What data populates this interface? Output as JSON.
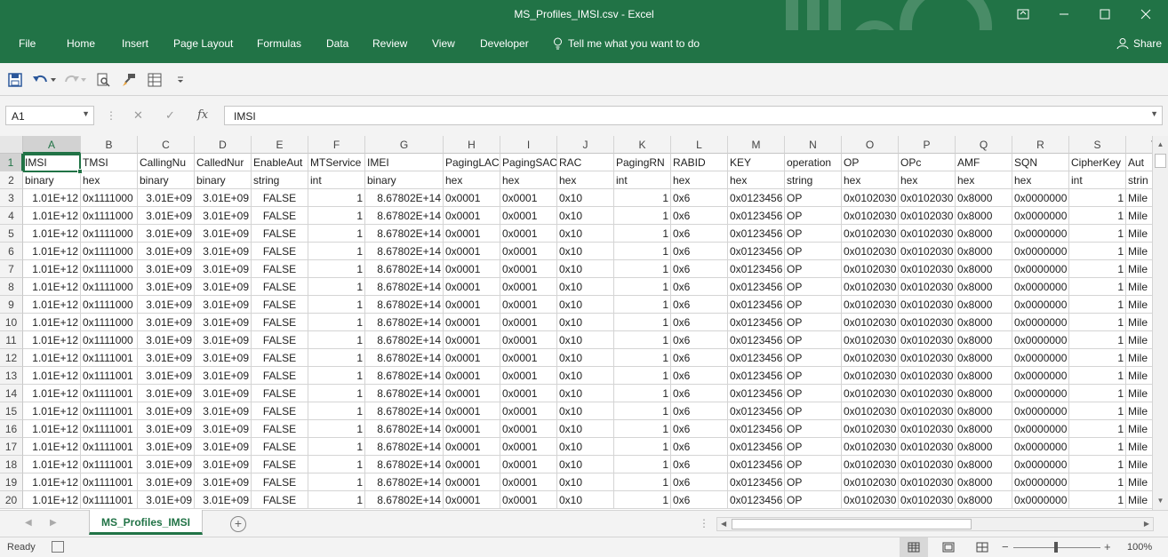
{
  "window": {
    "title": "MS_Profiles_IMSI.csv  -  Excel"
  },
  "ribbon": {
    "tabs": [
      "File",
      "Home",
      "Insert",
      "Page Layout",
      "Formulas",
      "Data",
      "Review",
      "View",
      "Developer"
    ],
    "tell_me": "Tell me what you want to do",
    "share": "Share"
  },
  "formula_bar": {
    "name_box": "A1",
    "fx": "fx",
    "content": "IMSI"
  },
  "grid": {
    "columns": [
      "A",
      "B",
      "C",
      "D",
      "E",
      "F",
      "G",
      "H",
      "I",
      "J",
      "K",
      "L",
      "M",
      "N",
      "O",
      "P",
      "Q",
      "R",
      "S",
      "T"
    ],
    "row_numbers": [
      "1",
      "2",
      "3",
      "4",
      "5",
      "6",
      "7",
      "8",
      "9",
      "10",
      "11",
      "12",
      "13",
      "14",
      "15",
      "16",
      "17",
      "18",
      "19",
      "20"
    ],
    "header_row": [
      "IMSI",
      "TMSI",
      "CallingNu",
      "CalledNur",
      "EnableAut",
      "MTService",
      "IMEI",
      "PagingLAC",
      "PagingSAC",
      "RAC",
      "PagingRN",
      "RABID",
      "KEY",
      "operation",
      "OP",
      "OPc",
      "AMF",
      "SQN",
      "CipherKey",
      "Aut"
    ],
    "type_row": [
      "binary",
      "hex",
      "binary",
      "binary",
      "string",
      "int",
      "binary",
      "hex",
      "hex",
      "hex",
      "int",
      "hex",
      "hex",
      "string",
      "hex",
      "hex",
      "hex",
      "hex",
      "int",
      "strin"
    ],
    "data_rows": [
      [
        "1.01E+12",
        "0x1111000",
        "3.01E+09",
        "3.01E+09",
        "FALSE",
        "1",
        "8.67802E+14",
        "0x0001",
        "0x0001",
        "0x10",
        "1",
        "0x6",
        "0x0123456",
        "OP",
        "0x0102030",
        "0x0102030",
        "0x8000",
        "0x0000000",
        "1",
        "Mile"
      ],
      [
        "1.01E+12",
        "0x1111000",
        "3.01E+09",
        "3.01E+09",
        "FALSE",
        "1",
        "8.67802E+14",
        "0x0001",
        "0x0001",
        "0x10",
        "1",
        "0x6",
        "0x0123456",
        "OP",
        "0x0102030",
        "0x0102030",
        "0x8000",
        "0x0000000",
        "1",
        "Mile"
      ],
      [
        "1.01E+12",
        "0x1111000",
        "3.01E+09",
        "3.01E+09",
        "FALSE",
        "1",
        "8.67802E+14",
        "0x0001",
        "0x0001",
        "0x10",
        "1",
        "0x6",
        "0x0123456",
        "OP",
        "0x0102030",
        "0x0102030",
        "0x8000",
        "0x0000000",
        "1",
        "Mile"
      ],
      [
        "1.01E+12",
        "0x1111000",
        "3.01E+09",
        "3.01E+09",
        "FALSE",
        "1",
        "8.67802E+14",
        "0x0001",
        "0x0001",
        "0x10",
        "1",
        "0x6",
        "0x0123456",
        "OP",
        "0x0102030",
        "0x0102030",
        "0x8000",
        "0x0000000",
        "1",
        "Mile"
      ],
      [
        "1.01E+12",
        "0x1111000",
        "3.01E+09",
        "3.01E+09",
        "FALSE",
        "1",
        "8.67802E+14",
        "0x0001",
        "0x0001",
        "0x10",
        "1",
        "0x6",
        "0x0123456",
        "OP",
        "0x0102030",
        "0x0102030",
        "0x8000",
        "0x0000000",
        "1",
        "Mile"
      ],
      [
        "1.01E+12",
        "0x1111000",
        "3.01E+09",
        "3.01E+09",
        "FALSE",
        "1",
        "8.67802E+14",
        "0x0001",
        "0x0001",
        "0x10",
        "1",
        "0x6",
        "0x0123456",
        "OP",
        "0x0102030",
        "0x0102030",
        "0x8000",
        "0x0000000",
        "1",
        "Mile"
      ],
      [
        "1.01E+12",
        "0x1111000",
        "3.01E+09",
        "3.01E+09",
        "FALSE",
        "1",
        "8.67802E+14",
        "0x0001",
        "0x0001",
        "0x10",
        "1",
        "0x6",
        "0x0123456",
        "OP",
        "0x0102030",
        "0x0102030",
        "0x8000",
        "0x0000000",
        "1",
        "Mile"
      ],
      [
        "1.01E+12",
        "0x1111000",
        "3.01E+09",
        "3.01E+09",
        "FALSE",
        "1",
        "8.67802E+14",
        "0x0001",
        "0x0001",
        "0x10",
        "1",
        "0x6",
        "0x0123456",
        "OP",
        "0x0102030",
        "0x0102030",
        "0x8000",
        "0x0000000",
        "1",
        "Mile"
      ],
      [
        "1.01E+12",
        "0x1111000",
        "3.01E+09",
        "3.01E+09",
        "FALSE",
        "1",
        "8.67802E+14",
        "0x0001",
        "0x0001",
        "0x10",
        "1",
        "0x6",
        "0x0123456",
        "OP",
        "0x0102030",
        "0x0102030",
        "0x8000",
        "0x0000000",
        "1",
        "Mile"
      ],
      [
        "1.01E+12",
        "0x1111001",
        "3.01E+09",
        "3.01E+09",
        "FALSE",
        "1",
        "8.67802E+14",
        "0x0001",
        "0x0001",
        "0x10",
        "1",
        "0x6",
        "0x0123456",
        "OP",
        "0x0102030",
        "0x0102030",
        "0x8000",
        "0x0000000",
        "1",
        "Mile"
      ],
      [
        "1.01E+12",
        "0x1111001",
        "3.01E+09",
        "3.01E+09",
        "FALSE",
        "1",
        "8.67802E+14",
        "0x0001",
        "0x0001",
        "0x10",
        "1",
        "0x6",
        "0x0123456",
        "OP",
        "0x0102030",
        "0x0102030",
        "0x8000",
        "0x0000000",
        "1",
        "Mile"
      ],
      [
        "1.01E+12",
        "0x1111001",
        "3.01E+09",
        "3.01E+09",
        "FALSE",
        "1",
        "8.67802E+14",
        "0x0001",
        "0x0001",
        "0x10",
        "1",
        "0x6",
        "0x0123456",
        "OP",
        "0x0102030",
        "0x0102030",
        "0x8000",
        "0x0000000",
        "1",
        "Mile"
      ],
      [
        "1.01E+12",
        "0x1111001",
        "3.01E+09",
        "3.01E+09",
        "FALSE",
        "1",
        "8.67802E+14",
        "0x0001",
        "0x0001",
        "0x10",
        "1",
        "0x6",
        "0x0123456",
        "OP",
        "0x0102030",
        "0x0102030",
        "0x8000",
        "0x0000000",
        "1",
        "Mile"
      ],
      [
        "1.01E+12",
        "0x1111001",
        "3.01E+09",
        "3.01E+09",
        "FALSE",
        "1",
        "8.67802E+14",
        "0x0001",
        "0x0001",
        "0x10",
        "1",
        "0x6",
        "0x0123456",
        "OP",
        "0x0102030",
        "0x0102030",
        "0x8000",
        "0x0000000",
        "1",
        "Mile"
      ],
      [
        "1.01E+12",
        "0x1111001",
        "3.01E+09",
        "3.01E+09",
        "FALSE",
        "1",
        "8.67802E+14",
        "0x0001",
        "0x0001",
        "0x10",
        "1",
        "0x6",
        "0x0123456",
        "OP",
        "0x0102030",
        "0x0102030",
        "0x8000",
        "0x0000000",
        "1",
        "Mile"
      ],
      [
        "1.01E+12",
        "0x1111001",
        "3.01E+09",
        "3.01E+09",
        "FALSE",
        "1",
        "8.67802E+14",
        "0x0001",
        "0x0001",
        "0x10",
        "1",
        "0x6",
        "0x0123456",
        "OP",
        "0x0102030",
        "0x0102030",
        "0x8000",
        "0x0000000",
        "1",
        "Mile"
      ],
      [
        "1.01E+12",
        "0x1111001",
        "3.01E+09",
        "3.01E+09",
        "FALSE",
        "1",
        "8.67802E+14",
        "0x0001",
        "0x0001",
        "0x10",
        "1",
        "0x6",
        "0x0123456",
        "OP",
        "0x0102030",
        "0x0102030",
        "0x8000",
        "0x0000000",
        "1",
        "Mile"
      ],
      [
        "1.01E+12",
        "0x1111001",
        "3.01E+09",
        "3.01E+09",
        "FALSE",
        "1",
        "8.67802E+14",
        "0x0001",
        "0x0001",
        "0x10",
        "1",
        "0x6",
        "0x0123456",
        "OP",
        "0x0102030",
        "0x0102030",
        "0x8000",
        "0x0000000",
        "1",
        "Mile"
      ]
    ]
  },
  "sheets": {
    "active_tab": "MS_Profiles_IMSI"
  },
  "status": {
    "ready": "Ready",
    "zoom": "100%"
  },
  "colors": {
    "accent": "#217346"
  }
}
